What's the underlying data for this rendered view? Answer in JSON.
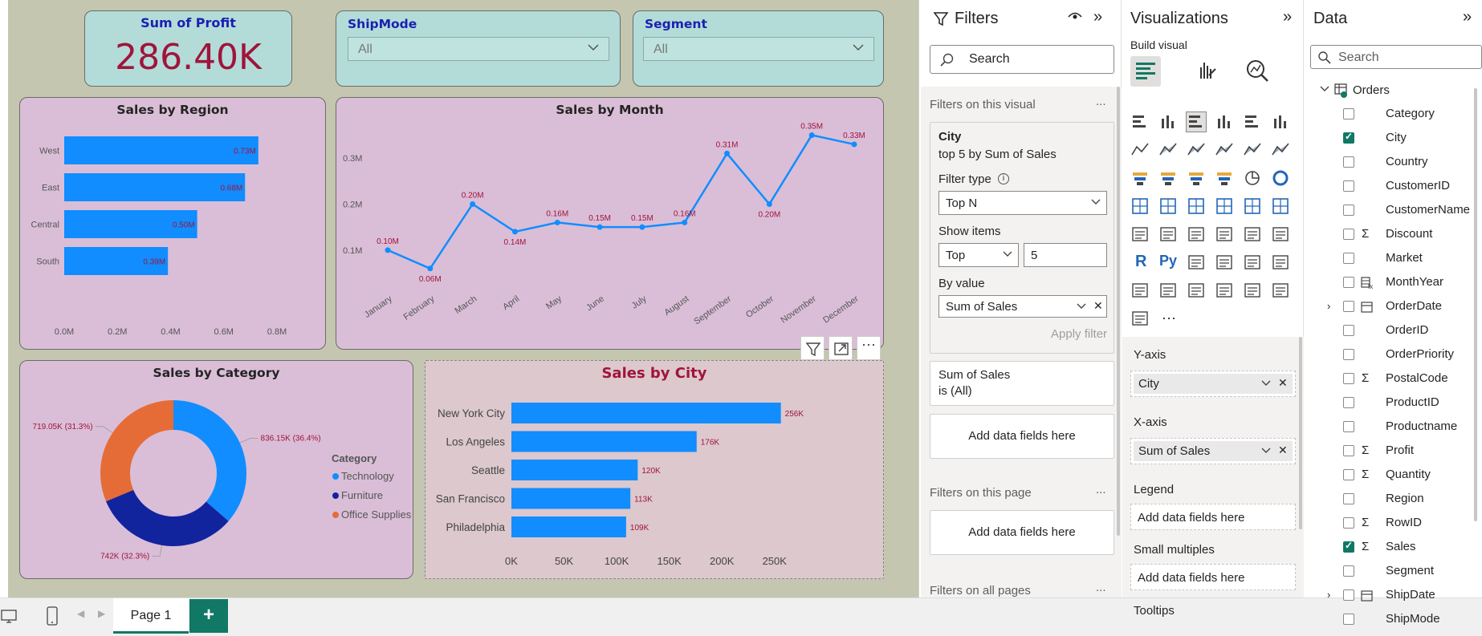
{
  "kpi": {
    "title": "Sum of Profit",
    "value": "286.40K"
  },
  "slicers": [
    {
      "label": "ShipMode",
      "value": "All"
    },
    {
      "label": "Segment",
      "value": "All"
    }
  ],
  "charts": {
    "region": {
      "title": "Sales by Region"
    },
    "month": {
      "title": "Sales by Month"
    },
    "category": {
      "title": "Sales by Category",
      "legend_title": "Category"
    },
    "city": {
      "title": "Sales by City"
    }
  },
  "chart_data": [
    {
      "type": "bar",
      "title": "Sales by Region",
      "orientation": "horizontal",
      "categories": [
        "West",
        "East",
        "Central",
        "South"
      ],
      "values": [
        0.73,
        0.68,
        0.5,
        0.39
      ],
      "data_labels": [
        "0.73M",
        "0.68M",
        "0.50M",
        "0.39M"
      ],
      "xticks": [
        "0.0M",
        "0.2M",
        "0.4M",
        "0.6M",
        "0.8M"
      ],
      "xlim": [
        0,
        0.8
      ],
      "color": "#118dff"
    },
    {
      "type": "line",
      "title": "Sales by Month",
      "x": [
        "January",
        "February",
        "March",
        "April",
        "May",
        "June",
        "July",
        "August",
        "September",
        "October",
        "November",
        "December"
      ],
      "values": [
        0.1,
        0.06,
        0.2,
        0.14,
        0.16,
        0.15,
        0.15,
        0.16,
        0.31,
        0.2,
        0.35,
        0.33
      ],
      "data_labels": [
        "0.10M",
        "0.06M",
        "0.20M",
        "0.14M",
        "0.16M",
        "0.15M",
        "0.15M",
        "0.16M",
        "0.31M",
        "0.20M",
        "0.35M",
        "0.33M"
      ],
      "yticks": [
        "0.1M",
        "0.2M",
        "0.3M"
      ],
      "ylim": [
        0.03,
        0.37
      ],
      "color": "#118dff"
    },
    {
      "type": "pie",
      "title": "Sales by Category",
      "donut": true,
      "legend_title": "Category",
      "categories": [
        "Technology",
        "Furniture",
        "Office Supplies"
      ],
      "values": [
        836.15,
        742,
        719.05
      ],
      "data_labels": [
        "836.15K (36.4%)",
        "742K (32.3%)",
        "719.05K (31.3%)"
      ],
      "colors": [
        "#118dff",
        "#12239e",
        "#e66c37"
      ]
    },
    {
      "type": "bar",
      "title": "Sales by City",
      "orientation": "horizontal",
      "categories": [
        "New York City",
        "Los Angeles",
        "Seattle",
        "San Francisco",
        "Philadelphia"
      ],
      "values": [
        256,
        176,
        120,
        113,
        109
      ],
      "data_labels": [
        "256K",
        "176K",
        "120K",
        "113K",
        "109K"
      ],
      "xticks": [
        "0K",
        "50K",
        "100K",
        "150K",
        "200K",
        "250K"
      ],
      "xlim": [
        0,
        270
      ],
      "color": "#118dff"
    }
  ],
  "bottom": {
    "page_tab": "Page 1",
    "add_label": "+"
  },
  "filters": {
    "title": "Filters",
    "search_placeholder": "Search",
    "on_visual_label": "Filters on this visual",
    "more": "...",
    "city_card": {
      "field": "City",
      "summary": "top 5 by Sum of Sales",
      "filter_type_label": "Filter type",
      "filter_type_value": "Top N",
      "show_items_label": "Show items",
      "show_items_dir": "Top",
      "show_items_count": "5",
      "by_value_label": "By value",
      "by_value_field": "Sum of Sales",
      "apply": "Apply filter"
    },
    "sales_card": {
      "field": "Sum of Sales",
      "value": "is (All)"
    },
    "add_fields": "Add data fields here",
    "on_page_label": "Filters on this page",
    "on_all_label": "Filters on all pages"
  },
  "viz": {
    "title": "Visualizations",
    "build_label": "Build visual",
    "yaxis_label": "Y-axis",
    "yaxis_field": "City",
    "xaxis_label": "X-axis",
    "xaxis_field": "Sum of Sales",
    "legend_label": "Legend",
    "small_mult_label": "Small multiples",
    "tooltips_label": "Tooltips",
    "add_fields": "Add data fields here"
  },
  "data": {
    "title": "Data",
    "search_placeholder": "Search",
    "table": "Orders",
    "fields": [
      {
        "name": "Category",
        "checked": false,
        "icon": ""
      },
      {
        "name": "City",
        "checked": true,
        "icon": ""
      },
      {
        "name": "Country",
        "checked": false,
        "icon": ""
      },
      {
        "name": "CustomerID",
        "checked": false,
        "icon": ""
      },
      {
        "name": "CustomerName",
        "checked": false,
        "icon": ""
      },
      {
        "name": "Discount",
        "checked": false,
        "icon": "sigma"
      },
      {
        "name": "Market",
        "checked": false,
        "icon": ""
      },
      {
        "name": "MonthYear",
        "checked": false,
        "icon": "calc"
      },
      {
        "name": "OrderDate",
        "checked": false,
        "icon": "date",
        "expand": true
      },
      {
        "name": "OrderID",
        "checked": false,
        "icon": ""
      },
      {
        "name": "OrderPriority",
        "checked": false,
        "icon": ""
      },
      {
        "name": "PostalCode",
        "checked": false,
        "icon": "sigma"
      },
      {
        "name": "ProductID",
        "checked": false,
        "icon": ""
      },
      {
        "name": "Productname",
        "checked": false,
        "icon": ""
      },
      {
        "name": "Profit",
        "checked": false,
        "icon": "sigma"
      },
      {
        "name": "Quantity",
        "checked": false,
        "icon": "sigma"
      },
      {
        "name": "Region",
        "checked": false,
        "icon": ""
      },
      {
        "name": "RowID",
        "checked": false,
        "icon": "sigma"
      },
      {
        "name": "Sales",
        "checked": true,
        "icon": "sigma"
      },
      {
        "name": "Segment",
        "checked": false,
        "icon": ""
      },
      {
        "name": "ShipDate",
        "checked": false,
        "icon": "date",
        "expand": true
      },
      {
        "name": "ShipMode",
        "checked": false,
        "icon": ""
      }
    ]
  },
  "colors": {
    "accent": "#117865",
    "bar": "#118dff",
    "label_red": "#a0143c",
    "slicer_label": "#1c1fb0"
  }
}
